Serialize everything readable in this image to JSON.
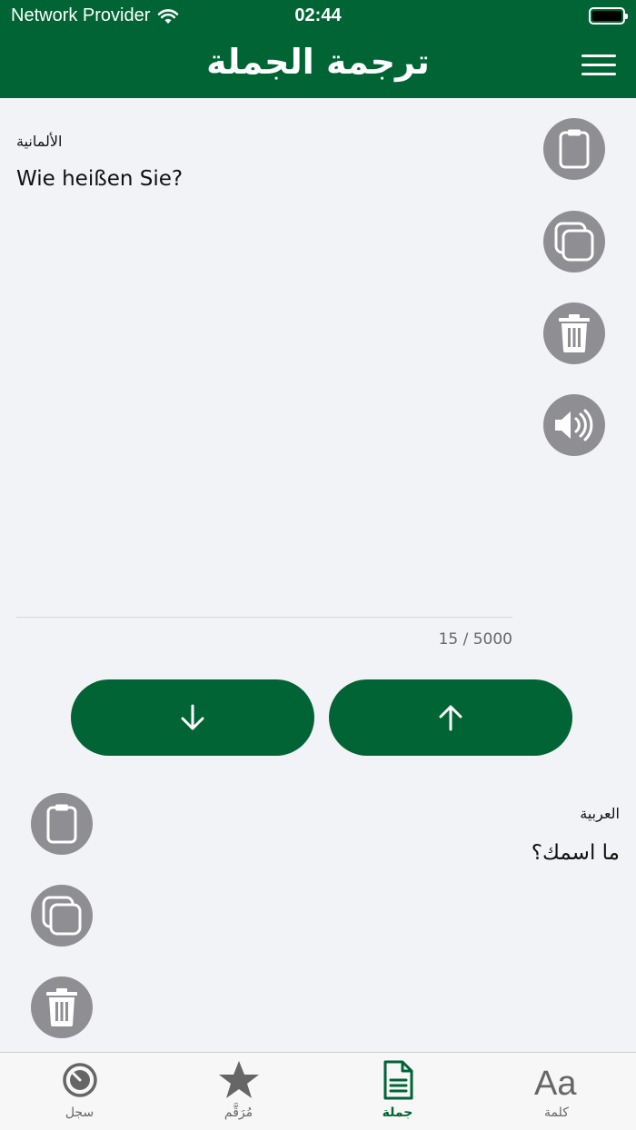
{
  "status": {
    "carrier": "Network Provider",
    "time": "02:44"
  },
  "header": {
    "title": "ترجمة الجملة"
  },
  "source": {
    "language": "الألمانية",
    "text": "Wie heißen Sie?",
    "counter": "15 / 5000"
  },
  "target": {
    "language": "العربية",
    "text": "ما اسمك؟"
  },
  "tabs": [
    {
      "label": "سجل",
      "icon": "history-icon",
      "active": false
    },
    {
      "label": "مُرَقَّم",
      "icon": "star-icon",
      "active": false
    },
    {
      "label": "جملة",
      "icon": "document-icon",
      "active": true
    },
    {
      "label": "كلمة",
      "icon": "text-format-icon",
      "active": false
    }
  ],
  "colors": {
    "primary": "#006434",
    "fab": "#8e8e93",
    "background": "#f2f3f7"
  }
}
